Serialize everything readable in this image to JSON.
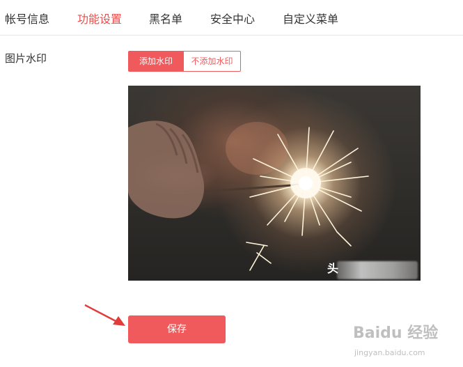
{
  "tabs": [
    {
      "label": "帐号信息",
      "active": false
    },
    {
      "label": "功能设置",
      "active": true
    },
    {
      "label": "黑名单",
      "active": false
    },
    {
      "label": "安全中心",
      "active": false
    },
    {
      "label": "自定义菜单",
      "active": false
    }
  ],
  "watermark_setting": {
    "label": "图片水印",
    "options": [
      "添加水印",
      "不添加水印"
    ],
    "selected": "添加水印"
  },
  "preview": {
    "watermark_text": "头"
  },
  "save_label": "保存",
  "brand_watermark": {
    "logo": "Baidu 经验",
    "site": "jingyan.baidu.com"
  },
  "colors": {
    "accent": "#f05a5c",
    "active_tab": "#e94d4a",
    "text": "#333333",
    "divider": "#e6e6e6"
  }
}
